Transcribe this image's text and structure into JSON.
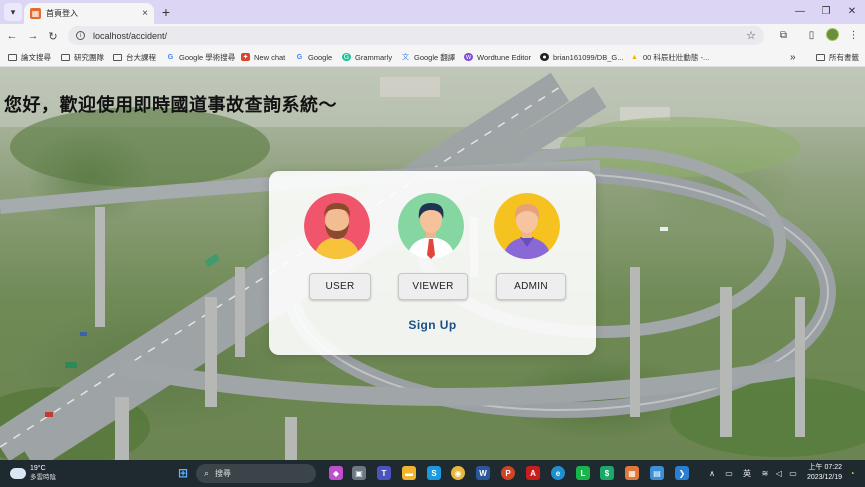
{
  "browser": {
    "tab_title": "首頁登入",
    "tab_close": "×",
    "new_tab": "+",
    "url": "localhost/accident/",
    "bookmarks": [
      {
        "label": "論文搜尋",
        "icon": "folder-icon"
      },
      {
        "label": "研究團隊",
        "icon": "folder-icon"
      },
      {
        "label": "台大課程",
        "icon": "folder-icon"
      },
      {
        "label": "Google 學術搜尋",
        "icon": "google-icon"
      },
      {
        "label": "New chat",
        "icon": "openai-icon"
      },
      {
        "label": "Google",
        "icon": "google-icon"
      },
      {
        "label": "Grammarly",
        "icon": "grammarly-icon"
      },
      {
        "label": "Google 翻譯",
        "icon": "translate-icon"
      },
      {
        "label": "Wordtune Editor",
        "icon": "wordtune-icon"
      },
      {
        "label": "brian161099/DB_G...",
        "icon": "github-icon"
      },
      {
        "label": "00 科辰壯壯動態 -...",
        "icon": "drive-icon"
      }
    ],
    "bookmarks_more": "»",
    "all_bookmarks": "所有書籤"
  },
  "page": {
    "headline": "您好，歡迎使用即時國道事故查詢系統～",
    "roles": [
      {
        "label": "USER",
        "avatar": "user-avatar-icon"
      },
      {
        "label": "VIEWER",
        "avatar": "viewer-avatar-icon"
      },
      {
        "label": "ADMIN",
        "avatar": "admin-avatar-icon"
      }
    ],
    "signup_link": "Sign Up"
  },
  "taskbar": {
    "temperature": "19°C",
    "weather_text": "多雲時陰",
    "search_placeholder": "搜尋",
    "ime": "英",
    "time": "上午 07:22",
    "date": "2023/12/19"
  },
  "colors": {
    "tab_strip": "#dcd6f4",
    "signup_link": "#1c4f86",
    "taskbar": "#1f2a30"
  }
}
